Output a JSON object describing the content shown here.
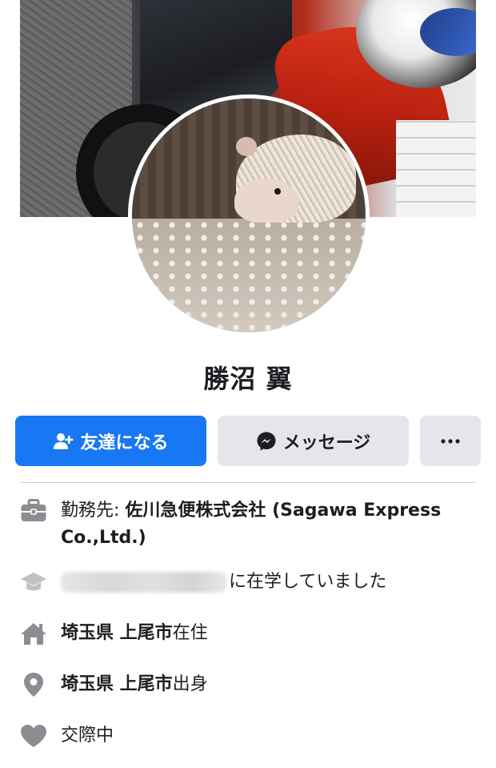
{
  "profile": {
    "name": "勝沼 翼"
  },
  "actions": {
    "add_friend_label": "友達になる",
    "message_label": "メッセージ",
    "more_label": "···"
  },
  "info": {
    "work_prefix": "勤務先: ",
    "work_value": "佐川急便株式会社 (Sagawa Express Co.,Ltd.)",
    "education_suffix": "に在学していました",
    "lives_in_place": "埼玉県 上尾市",
    "lives_in_suffix": "在住",
    "from_place": "埼玉県 上尾市",
    "from_suffix": "出身",
    "relationship": "交際中"
  },
  "colors": {
    "accent": "#1877f2",
    "button_gray": "#e4e6eb",
    "icon_gray": "#8a8d91"
  },
  "icons": {
    "add_friend": "person-add-icon",
    "message": "messenger-icon",
    "more": "more-dots-icon",
    "work": "briefcase-icon",
    "education": "graduation-cap-icon",
    "home": "home-icon",
    "location": "location-pin-icon",
    "relationship": "heart-icon"
  }
}
